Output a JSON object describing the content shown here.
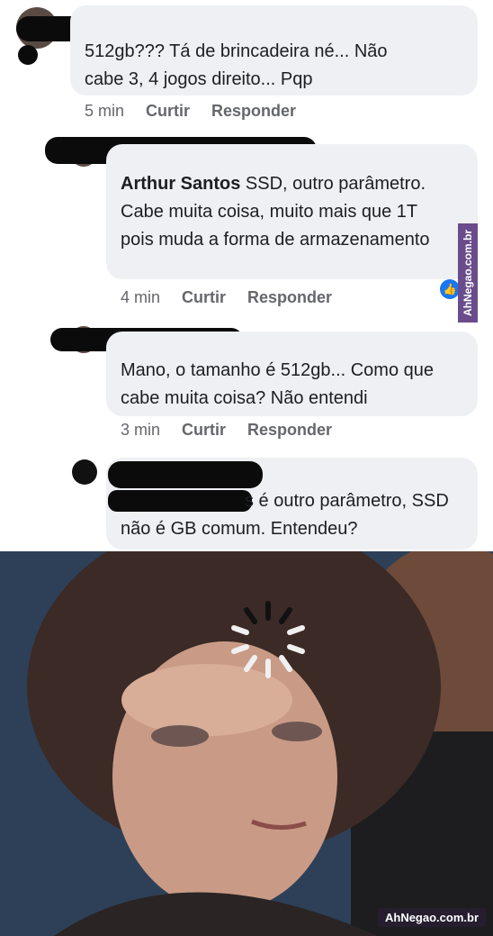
{
  "comments": [
    {
      "text": "512gb??? Tá de brincadeira né... Não cabe 3, 4 jogos direito... Pqp",
      "time": "5 min",
      "like": "Curtir",
      "reply": "Responder"
    },
    {
      "author": "Arthur Santos",
      "text": "SSD, outro parâmetro. Cabe muita coisa, muito mais que 1T pois muda a forma de armazenamento",
      "time": "4 min",
      "like": "Curtir",
      "reply": "Responder"
    },
    {
      "text": "Mano, o tamanho é 512gb... Como que cabe muita coisa? Não entendi",
      "time": "3 min",
      "like": "Curtir",
      "reply": "Responder"
    },
    {
      "text": "s é outro parâmetro, SSD não é GB comum. Entendeu?"
    }
  ],
  "watermark_side": "AhNegao.com.br",
  "watermark_bottom": "AhNegao.com.br",
  "icons": {
    "reaction": "like-icon",
    "loading": "loading-spinner-icon"
  },
  "colors": {
    "bubble": "#eef0f4",
    "meta_text": "#65676b",
    "like_blue": "#1877f2",
    "watermark": "#6a4c8c"
  }
}
